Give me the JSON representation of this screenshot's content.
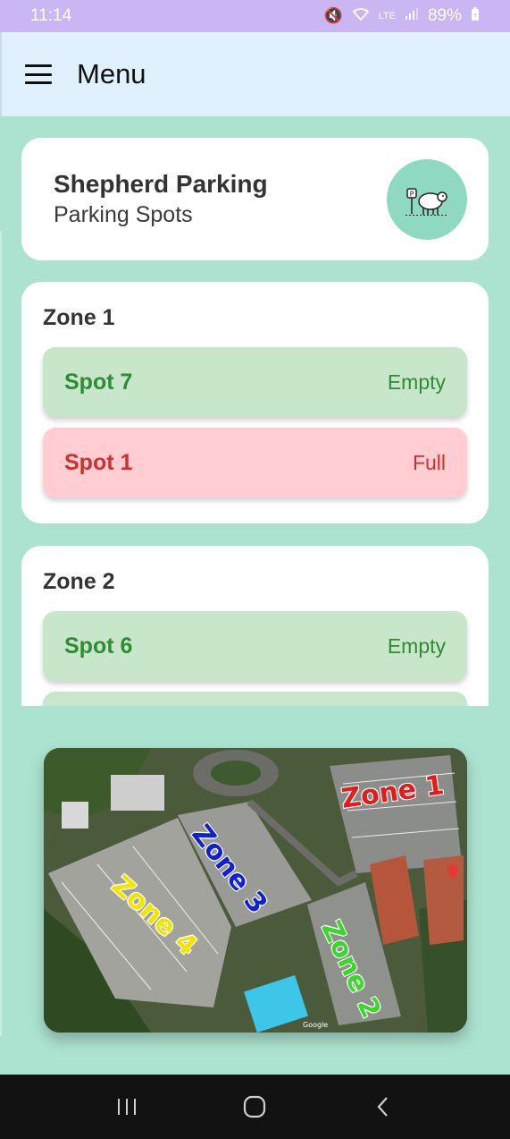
{
  "status_bar": {
    "time": "11:14",
    "battery": "89%",
    "network": "LTE"
  },
  "app_bar": {
    "title": "Menu"
  },
  "header": {
    "title": "Shepherd Parking",
    "subtitle": "Parking Spots",
    "logo_icon": "sheep-parking-logo"
  },
  "zones": [
    {
      "title": "Zone 1",
      "spots": [
        {
          "name": "Spot 7",
          "status": "Empty"
        },
        {
          "name": "Spot 1",
          "status": "Full"
        }
      ]
    },
    {
      "title": "Zone 2",
      "spots": [
        {
          "name": "Spot 6",
          "status": "Empty"
        },
        {
          "name": "",
          "status": ""
        }
      ]
    }
  ],
  "map": {
    "zone_labels": [
      {
        "text": "Zone 1",
        "color": "#e31b1b"
      },
      {
        "text": "Zone 3",
        "color": "#1020d8"
      },
      {
        "text": "Zone 4",
        "color": "#f2e600"
      },
      {
        "text": "Zone 2",
        "color": "#39d82a"
      }
    ],
    "attribution": "Google"
  },
  "colors": {
    "background": "#ace3d0",
    "appbar": "#e0f0fc",
    "empty": "#c8e6c9",
    "full": "#ffcdd2",
    "empty_text": "#2e8b36",
    "full_text": "#d32f2f"
  }
}
